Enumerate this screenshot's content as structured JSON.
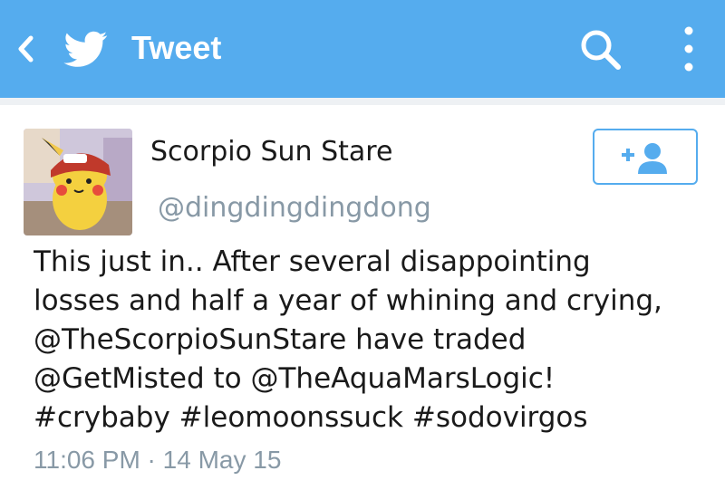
{
  "header": {
    "title": "Tweet",
    "back_icon": "chevron-left-icon",
    "logo_icon": "twitter-bird-icon",
    "search_icon": "search-icon",
    "more_icon": "more-vertical-icon",
    "background_color": "#55acee"
  },
  "tweet": {
    "display_name": "Scorpio Sun Stare",
    "handle": "@dingdingdingdong",
    "follow_icon": "add-user-icon",
    "lines": [
      "This just in.. After several disappointing",
      "losses and half a year of whining and crying,",
      "@TheScorpioSunStare have traded",
      "@GetMisted to @TheAquaMarsLogic!",
      "#crybaby #leomoonssuck #sodovirgos"
    ],
    "timestamp": "11:06 PM · 14 May 15"
  }
}
